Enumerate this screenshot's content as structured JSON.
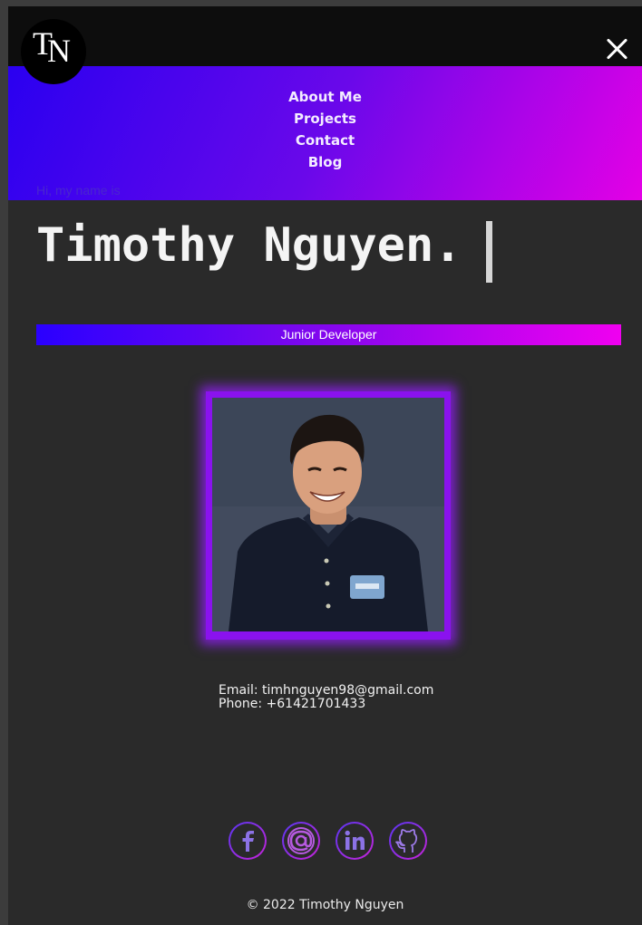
{
  "logo": {
    "first": "T",
    "second": "N"
  },
  "nav": {
    "items": [
      {
        "label": "About Me"
      },
      {
        "label": "Projects"
      },
      {
        "label": "Contact"
      },
      {
        "label": "Blog"
      }
    ],
    "close_icon": "close-icon"
  },
  "hero": {
    "greeting": "Hi, my name is",
    "name": "Timothy Nguyen.",
    "role": "Junior Developer"
  },
  "contact": {
    "email": "Email: timhnguyen98@gmail.com",
    "phone": "Phone: +61421701433"
  },
  "social": [
    "facebook-icon",
    "email-at-icon",
    "linkedin-icon",
    "github-icon"
  ],
  "footer": {
    "copyright": "© 2022 Timothy Nguyen"
  },
  "colors": {
    "background": "#2a2a2a",
    "gradient_start": "#2a00f0",
    "gradient_end": "#e400e6",
    "glow": "#8a12ee"
  }
}
